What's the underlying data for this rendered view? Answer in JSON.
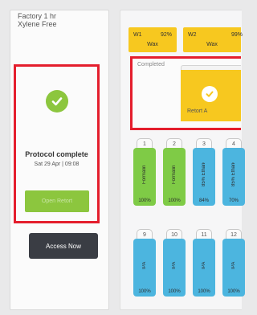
{
  "protocol": {
    "name_line1": "Factory 1 hr",
    "name_line2": "Xylene Free",
    "status_title": "Protocol complete",
    "status_date": "Sat 29 Apr | 09:08",
    "open_button": "Open Retort",
    "access_button": "Access Now"
  },
  "wax_baths": [
    {
      "name": "W1",
      "level": "92%",
      "type": "Wax"
    },
    {
      "name": "W2",
      "level": "99%",
      "type": "Wax"
    }
  ],
  "retort": {
    "status": "Completed",
    "name": "Retort A"
  },
  "bottles_row1": [
    {
      "number": "1",
      "reagent": "Formalin",
      "level": "100%"
    },
    {
      "number": "2",
      "reagent": "Formalin",
      "level": "100%"
    },
    {
      "number": "3",
      "reagent": "85% Ethanol",
      "level": "84%"
    },
    {
      "number": "4",
      "reagent": "85% Ethanol",
      "level": "70%"
    }
  ],
  "bottles_row2": [
    {
      "number": "9",
      "reagent": "IPA",
      "level": "100%"
    },
    {
      "number": "10",
      "reagent": "IPA",
      "level": "100%"
    },
    {
      "number": "11",
      "reagent": "IPA",
      "level": "100%"
    },
    {
      "number": "12",
      "reagent": "IPA",
      "level": "100%"
    }
  ],
  "colors": {
    "accent_red": "#e41e2d",
    "wax_yellow": "#f7c81f",
    "formalin_green": "#7fcb46",
    "ethanol_blue": "#4cb5df",
    "complete_green": "#8cc63e"
  }
}
